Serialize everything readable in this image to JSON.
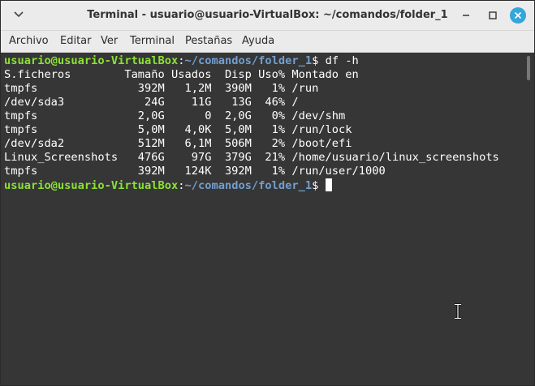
{
  "window": {
    "title": "Terminal - usuario@usuario-VirtualBox: ~/comandos/folder_1",
    "controls": {
      "menu_icon": "chevron-down-icon",
      "minimize": "minimize-icon",
      "maximize": "maximize-icon",
      "close": "close-icon"
    },
    "accent_color": "#35a6d9"
  },
  "menubar": {
    "items": [
      "Archivo",
      "Editar",
      "Ver",
      "Terminal",
      "Pestañas",
      "Ayuda"
    ]
  },
  "terminal": {
    "colors": {
      "background": "#363636",
      "user": "#8ae234",
      "path": "#729fcf",
      "text": "#ffffff"
    },
    "prompt": {
      "user_host": "usuario@usuario-VirtualBox",
      "sep": ":",
      "path": "~/comandos/folder_1",
      "symbol": "$"
    },
    "command": " df -h",
    "output": [
      "S.ficheros        Tamaño Usados  Disp Uso% Montado en",
      "tmpfs               392M   1,2M  390M   1% /run",
      "/dev/sda3            24G    11G   13G  46% /",
      "tmpfs               2,0G      0  2,0G   0% /dev/shm",
      "tmpfs               5,0M   4,0K  5,0M   1% /run/lock",
      "/dev/sda2           512M   6,1M  506M   2% /boot/efi",
      "Linux_Screenshots   476G    97G  379G  21% /home/usuario/linux_screenshots",
      "tmpfs               392M   124K  392M   1% /run/user/1000"
    ]
  }
}
